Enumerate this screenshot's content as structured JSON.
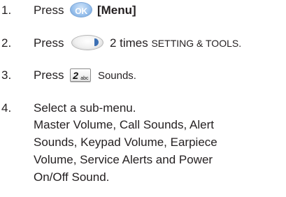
{
  "steps": [
    {
      "number": "1.",
      "press": "Press",
      "key_label": "OK",
      "menu": "[Menu]",
      "icon": "ok-key-icon"
    },
    {
      "number": "2.",
      "press": "Press",
      "text": "2 times",
      "target": "SETTING & TOOLS.",
      "icon": "nav-right-key-icon"
    },
    {
      "number": "3.",
      "press": "Press",
      "key_digit": "2",
      "key_letters": "abc",
      "target": "Sounds.",
      "icon": "key-2-icon"
    },
    {
      "number": "4.",
      "text": "Select a sub-menu.",
      "submenu_lines": [
        "Master Volume, Call Sounds, Alert",
        "Sounds, Keypad Volume, Earpiece",
        "Volume, Service Alerts and Power",
        "On/Off Sound."
      ]
    }
  ],
  "colors": {
    "text": "#231f20",
    "ok_key": "#9cc3ee",
    "nav_arrow": "#3b6fb3"
  }
}
